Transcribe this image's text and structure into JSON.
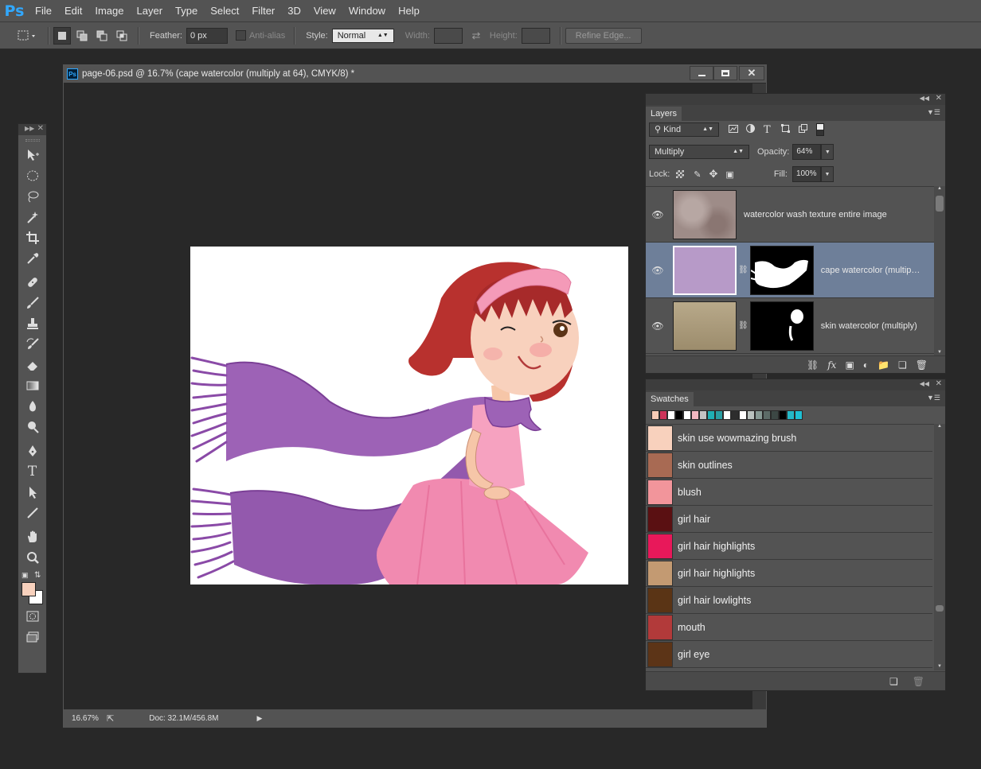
{
  "app": {
    "logo": "Ps"
  },
  "menu": [
    "File",
    "Edit",
    "Image",
    "Layer",
    "Type",
    "Select",
    "Filter",
    "3D",
    "View",
    "Window",
    "Help"
  ],
  "options": {
    "feather_label": "Feather:",
    "feather_value": "0 px",
    "antialias_label": "Anti-alias",
    "style_label": "Style:",
    "style_value": "Normal",
    "width_label": "Width:",
    "height_label": "Height:",
    "refine_label": "Refine Edge..."
  },
  "document": {
    "title": "page-06.psd @ 16.7% (cape watercolor (multiply at 64), CMYK/8) *",
    "zoom": "16.67%",
    "doc_size": "Doc: 32.1M/456.8M"
  },
  "layers": {
    "tab": "Layers",
    "filter": "Kind",
    "blend_mode": "Multiply",
    "opacity_label": "Opacity:",
    "opacity_value": "64%",
    "lock_label": "Lock:",
    "fill_label": "Fill:",
    "fill_value": "100%",
    "items": [
      {
        "name": "watercolor wash texture entire image",
        "selected": false
      },
      {
        "name": "cape watercolor (multiply ...",
        "selected": true
      },
      {
        "name": "skin watercolor (multiply)",
        "selected": false
      }
    ]
  },
  "swatches": {
    "tab": "Swatches",
    "strip_colors": [
      "#f7cbb5",
      "#cc3359",
      "#ffffff",
      "#000000",
      "#ffffff",
      "#f2b7c0",
      "#c3c3c3",
      "#1fb0b4",
      "#2a9fa3",
      "#ffffff",
      "#2d2d2d",
      "#ffffff",
      "#b9c2bf",
      "#879a95",
      "#5c6b67",
      "#3c4744",
      "#000000",
      "#25b8c7",
      "#1fc0d4"
    ],
    "items": [
      {
        "name": "skin use wowmazing brush",
        "color": "#f8d1bd"
      },
      {
        "name": "skin outlines",
        "color": "#a86a53"
      },
      {
        "name": "blush",
        "color": "#f2959b"
      },
      {
        "name": "girl hair",
        "color": "#5a1012"
      },
      {
        "name": "girl hair highlights",
        "color": "#e8185a"
      },
      {
        "name": "girl hair highlights",
        "color": "#c39a72"
      },
      {
        "name": "girl hair lowlights",
        "color": "#5a3415"
      },
      {
        "name": "mouth",
        "color": "#b23a3a"
      },
      {
        "name": "girl eye",
        "color": "#5c3417"
      }
    ]
  },
  "colors": {
    "foreground": "#f8d1bd",
    "background": "#ffffff",
    "accent": "#31a8ff",
    "selected_layer": "#6e7f99"
  }
}
